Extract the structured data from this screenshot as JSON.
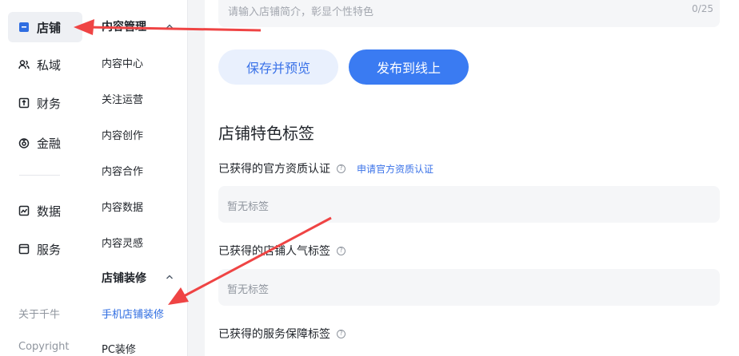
{
  "rail": {
    "items": [
      {
        "label": "店铺",
        "icon": "store-icon",
        "active": true
      },
      {
        "label": "私域",
        "icon": "users-icon"
      },
      {
        "label": "财务",
        "icon": "finance-icon"
      },
      {
        "label": "金融",
        "icon": "coin-icon"
      },
      {
        "label": "数据",
        "icon": "chart-icon"
      },
      {
        "label": "服务",
        "icon": "service-icon"
      }
    ],
    "footer": {
      "about": "关于千牛",
      "copyright": "Copyright"
    }
  },
  "submenu": {
    "group1": "内容管理",
    "items1": [
      "内容中心",
      "关注运营",
      "内容创作",
      "内容合作",
      "内容数据",
      "内容灵感"
    ],
    "group2": "店铺装修",
    "items2": [
      "手机店铺装修",
      "PC装修"
    ]
  },
  "main": {
    "intro_placeholder": "请输入店铺简介，彰显个性特色",
    "intro_count": "0/25",
    "save_preview": "保存并预览",
    "publish": "发布到线上",
    "section_title": "店铺特色标签",
    "fields": [
      {
        "label": "已获得的官方资质认证",
        "link": "申请官方资质认证",
        "empty": "暂无标签"
      },
      {
        "label": "已获得的店铺人气标签",
        "empty": "暂无标签"
      },
      {
        "label": "已获得的服务保障标签"
      }
    ]
  },
  "colors": {
    "accent": "#3a7bf2",
    "arrow": "#ef4444"
  }
}
